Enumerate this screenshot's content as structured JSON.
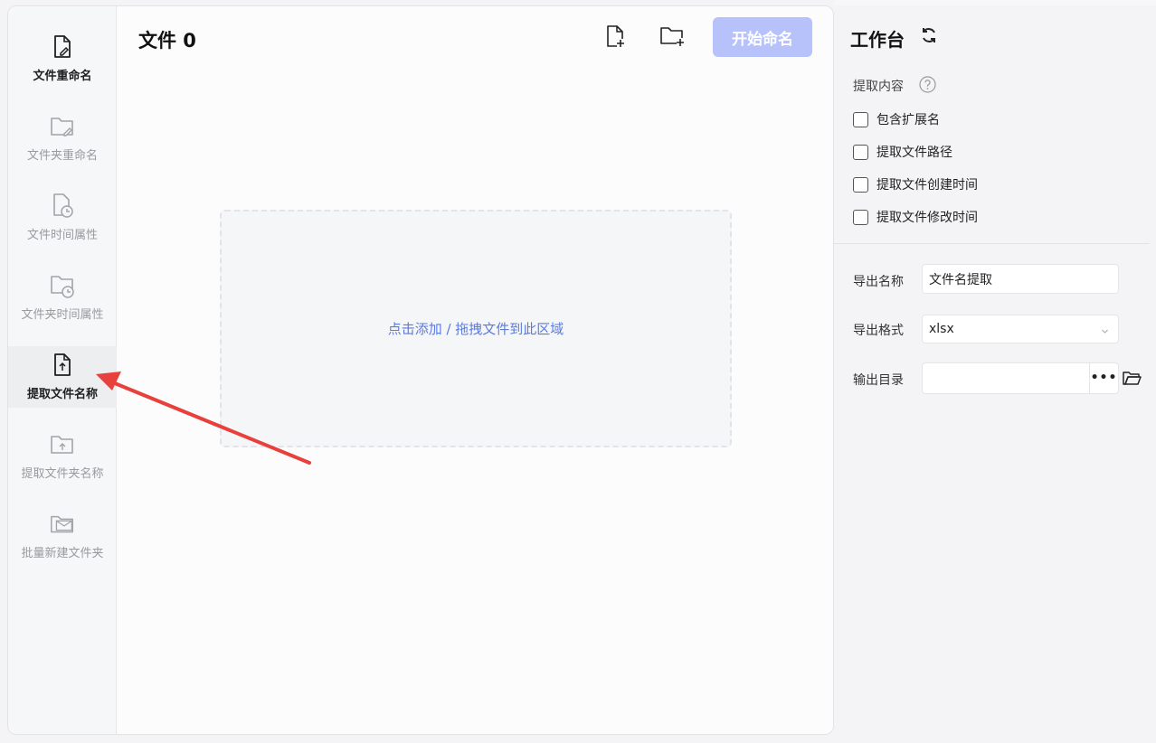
{
  "sidebar": {
    "items": [
      {
        "label": "文件重命名",
        "icon": "file-edit-icon"
      },
      {
        "label": "文件夹重命名",
        "icon": "folder-edit-icon"
      },
      {
        "label": "文件时间属性",
        "icon": "file-clock-icon"
      },
      {
        "label": "文件夹时间属性",
        "icon": "folder-clock-icon"
      },
      {
        "label": "提取文件名称",
        "icon": "file-upload-icon"
      },
      {
        "label": "提取文件夹名称",
        "icon": "folder-upload-icon"
      },
      {
        "label": "批量新建文件夹",
        "icon": "folder-mail-icon"
      }
    ]
  },
  "main": {
    "title": "文件 0",
    "add_file_icon": "add-file-icon",
    "add_folder_icon": "add-folder-icon",
    "start_button": "开始命名",
    "dropzone_text": "点击添加 / 拖拽文件到此区域"
  },
  "workbench": {
    "title": "工作台",
    "extract_label": "提取内容",
    "options": [
      {
        "label": "包含扩展名",
        "checked": false
      },
      {
        "label": "提取文件路径",
        "checked": false
      },
      {
        "label": "提取文件创建时间",
        "checked": false
      },
      {
        "label": "提取文件修改时间",
        "checked": false
      }
    ],
    "export_name_label": "导出名称",
    "export_name_value": "文件名提取",
    "export_format_label": "导出格式",
    "export_format_value": "xlsx",
    "output_dir_label": "输出目录",
    "output_dir_value": "",
    "browse_button": "•••"
  },
  "colors": {
    "accent": "#b7c2fb",
    "dropzone_text": "#5b7be0",
    "annotation_arrow": "#e8403c"
  }
}
